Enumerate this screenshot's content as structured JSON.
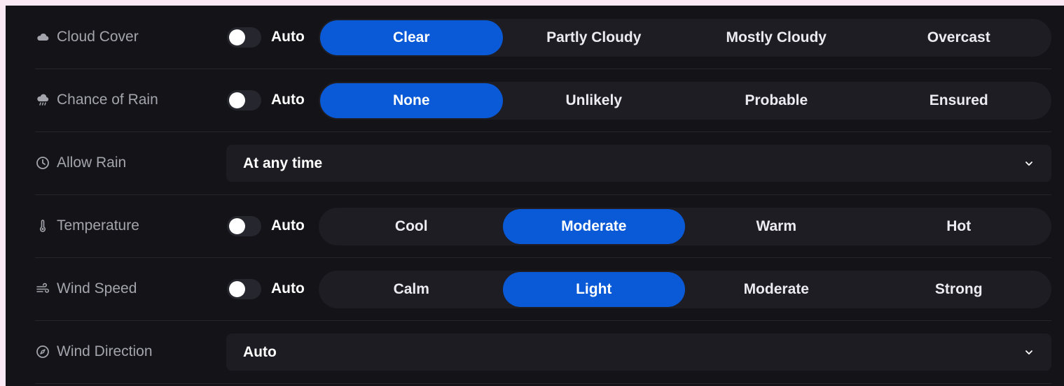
{
  "rows": [
    {
      "label": "Cloud Cover",
      "icon": "cloud-icon",
      "auto_label": "Auto",
      "auto_on": false,
      "options": [
        "Clear",
        "Partly Cloudy",
        "Mostly Cloudy",
        "Overcast"
      ],
      "selected": "Clear"
    },
    {
      "label": "Chance of Rain",
      "icon": "rain-cloud-icon",
      "auto_label": "Auto",
      "auto_on": false,
      "options": [
        "None",
        "Unlikely",
        "Probable",
        "Ensured"
      ],
      "selected": "None"
    },
    {
      "label": "Allow Rain",
      "icon": "clock-icon",
      "value": "At any time"
    },
    {
      "label": "Temperature",
      "icon": "thermometer-icon",
      "auto_label": "Auto",
      "auto_on": false,
      "options": [
        "Cool",
        "Moderate",
        "Warm",
        "Hot"
      ],
      "selected": "Moderate"
    },
    {
      "label": "Wind Speed",
      "icon": "wind-icon",
      "auto_label": "Auto",
      "auto_on": false,
      "options": [
        "Calm",
        "Light",
        "Moderate",
        "Strong"
      ],
      "selected": "Light"
    },
    {
      "label": "Wind Direction",
      "icon": "compass-icon",
      "value": "Auto"
    }
  ],
  "colors": {
    "background": "#131318",
    "accent": "#0a59d6",
    "segment_track": "#1d1d23",
    "label_text": "#a4a4ad"
  }
}
